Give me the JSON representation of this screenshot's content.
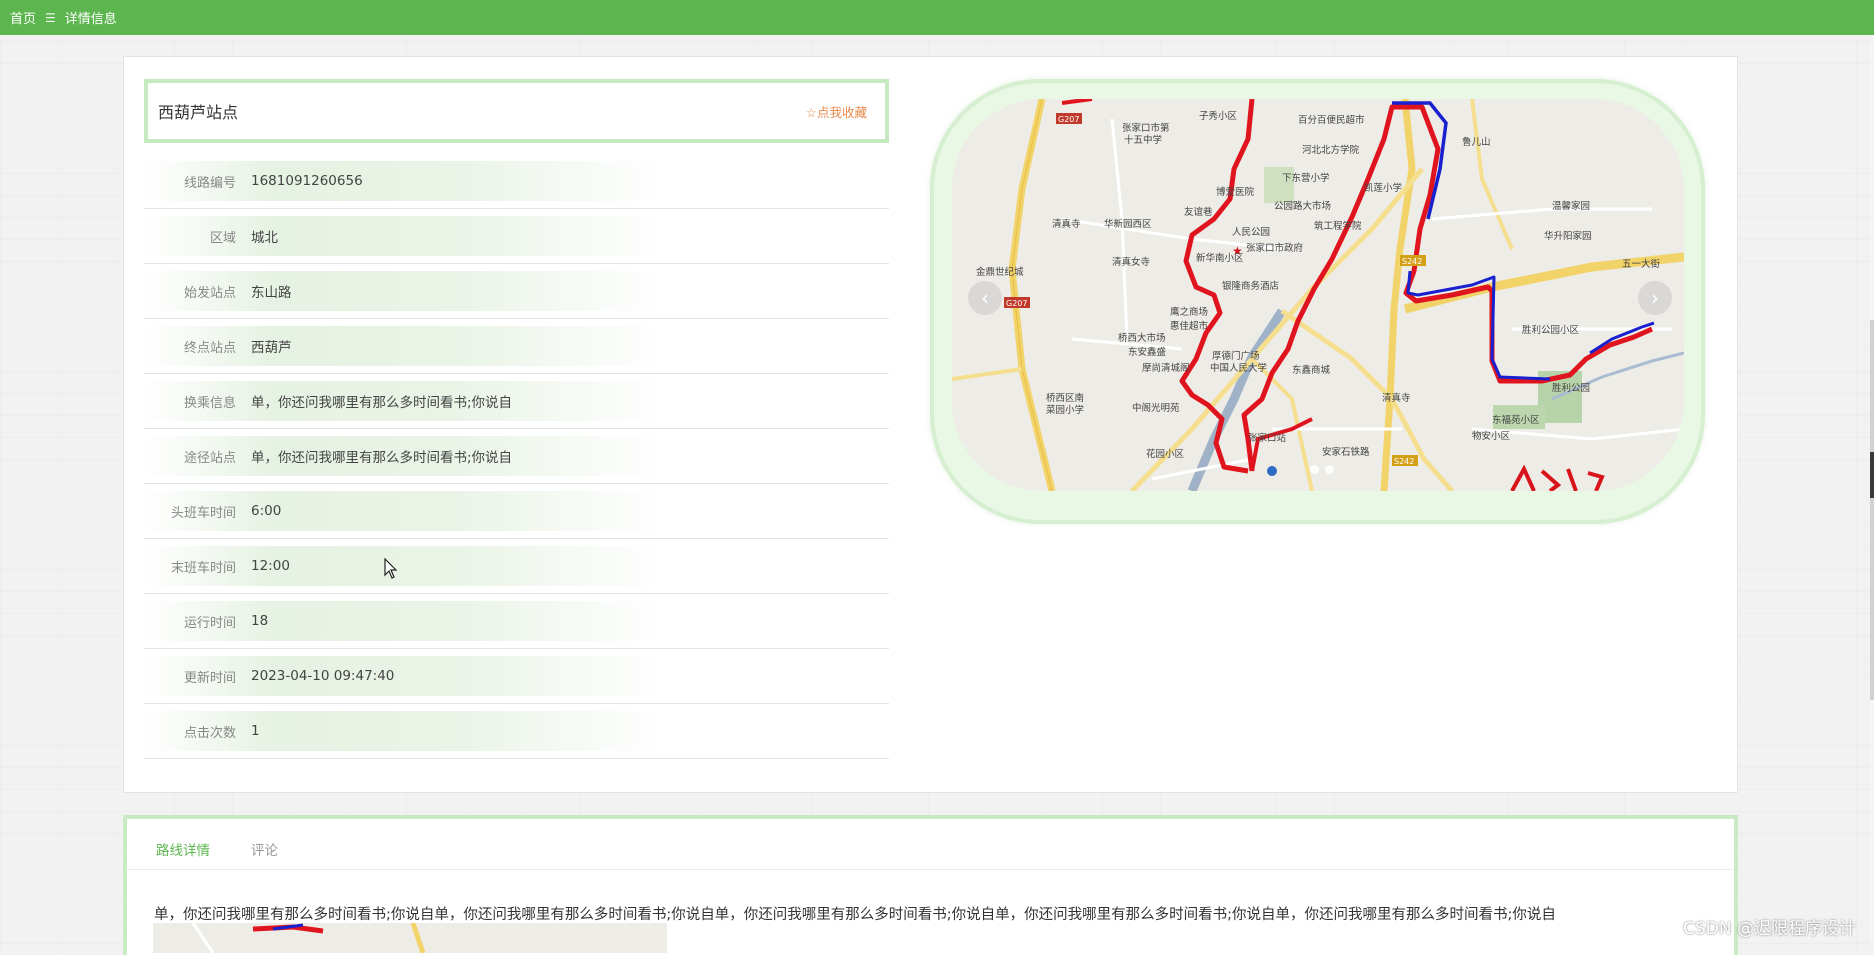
{
  "breadcrumb": {
    "home": "首页",
    "separator": "☰",
    "current": "详情信息"
  },
  "title": "西葫芦站点",
  "favorite": {
    "icon": "star-outline-icon",
    "label": "☆点我收藏"
  },
  "fields": [
    {
      "label": "线路编号",
      "value": "1681091260656"
    },
    {
      "label": "区域",
      "value": "城北"
    },
    {
      "label": "始发站点",
      "value": "东山路"
    },
    {
      "label": "终点站点",
      "value": "西葫芦"
    },
    {
      "label": "换乘信息",
      "value": "单，你还问我哪里有那么多时间看书;你说自"
    },
    {
      "label": "途径站点",
      "value": "单，你还问我哪里有那么多时间看书;你说自"
    },
    {
      "label": "头班车时间",
      "value": "6:00"
    },
    {
      "label": "末班车时间",
      "value": "12:00"
    },
    {
      "label": "运行时间",
      "value": "18"
    },
    {
      "label": "更新时间",
      "value": "2023-04-10 09:47:40"
    },
    {
      "label": "点击次数",
      "value": "1"
    }
  ],
  "carousel": {
    "prev_icon": "chevron-left-icon",
    "next_icon": "chevron-right-icon",
    "prev_glyph": "‹",
    "next_glyph": "›",
    "map_labels": {
      "l1": "子秀小区",
      "l2": "张家口市第",
      "l3": "十五中学",
      "l4": "百分百便民超市",
      "l5": "河北北方学院",
      "l6": "下东营小学",
      "l7": "博爱医院",
      "l8": "公园路大市场",
      "l9": "凯莲小学",
      "l10": "鲁儿山",
      "l11": "清真寺",
      "l12": "华新园西区",
      "l13": "人民公园",
      "l14": "筑工程学院",
      "l15": "华升阳家园",
      "l16": "金鼎世纪城",
      "l17": "清真女寺",
      "l18": "新华南小区",
      "l19": "张家口市政府",
      "l20": "五一大街",
      "l21": "温馨家园",
      "l22": "银隆商务酒店",
      "l23": "鹰之商场",
      "l24": "惠佳超市",
      "l25": "桥西大市场",
      "l26": "东安鑫盛",
      "l27": "厚德门广场",
      "l28": "东鑫商城",
      "l29": "胜利公园小区",
      "l30": "摩尚清城阁",
      "l31": "中国人民大学",
      "l32": "胜利公园",
      "l33": "桥西区南",
      "l34": "菜园小学",
      "l35": "中阁光明苑",
      "l36": "清真寺",
      "l37": "东福苑小区",
      "l38": "张家口站",
      "l39": "物安小区",
      "l40": "花园小区",
      "l41": "安家石铁路",
      "l42": "G207",
      "l43": "G207",
      "l44": "S242",
      "l45": "S242",
      "l46": "友谊巷"
    }
  },
  "tabs": [
    {
      "label": "路线详情",
      "active": true
    },
    {
      "label": "评论",
      "active": false
    }
  ],
  "detail_text": "单，你还问我哪里有那么多时间看书;你说自单，你还问我哪里有那么多时间看书;你说自单，你还问我哪里有那么多时间看书;你说自单，你还问我哪里有那么多时间看书;你说自单，你还问我哪里有那么多时间看书;你说自",
  "watermark": "CSDN @迟限程序设计",
  "colors": {
    "primary": "#5cb54e",
    "favorite": "#e6894a",
    "route_red": "#e0141e",
    "route_blue": "#1820d0"
  }
}
